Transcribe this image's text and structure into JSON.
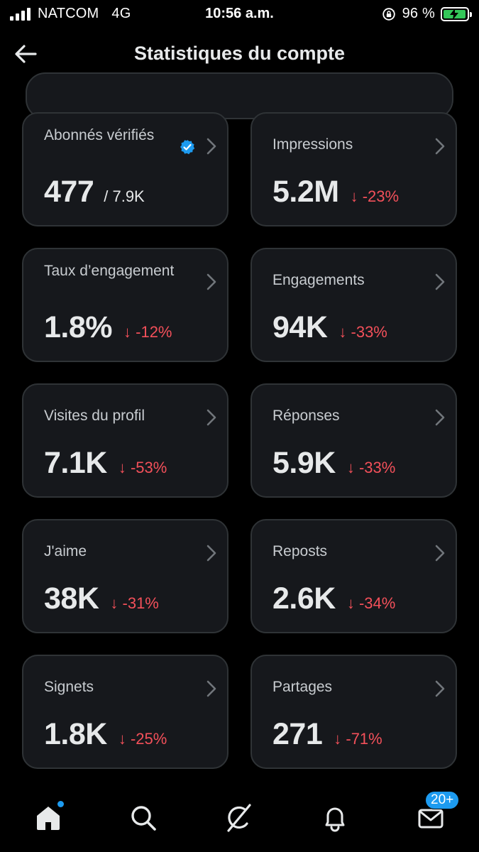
{
  "status_bar": {
    "carrier": "NATCOM",
    "network": "4G",
    "time": "10:56 a.m.",
    "battery": "96 %",
    "battery_level": 0.96
  },
  "header": {
    "title": "Statistiques du compte",
    "back_icon": "arrow-left-icon"
  },
  "colors": {
    "background": "#000000",
    "card": "#16181c",
    "card_border": "#2f3336",
    "negative": "#f3505a",
    "accent": "#1d9bf0"
  },
  "cards": [
    {
      "label": "Abonnés vérifiés",
      "value": "477",
      "sub": "/ 7.9K",
      "change": "",
      "verified": true
    },
    {
      "label": "Impressions",
      "value": "5.2M",
      "sub": "",
      "change": "↓ -23%"
    },
    {
      "label": "Taux d’engagement",
      "value": "1.8%",
      "sub": "",
      "change": "↓ -12%"
    },
    {
      "label": "Engagements",
      "value": "94K",
      "sub": "",
      "change": "↓ -33%"
    },
    {
      "label": "Visites du profil",
      "value": "7.1K",
      "sub": "",
      "change": "↓ -53%"
    },
    {
      "label": "Réponses",
      "value": "5.9K",
      "sub": "",
      "change": "↓ -33%"
    },
    {
      "label": "J'aime",
      "value": "38K",
      "sub": "",
      "change": "↓ -31%"
    },
    {
      "label": "Reposts",
      "value": "2.6K",
      "sub": "",
      "change": "↓ -34%"
    },
    {
      "label": "Signets",
      "value": "1.8K",
      "sub": "",
      "change": "↓ -25%"
    },
    {
      "label": "Partages",
      "value": "271",
      "sub": "",
      "change": "↓ -71%"
    }
  ],
  "bottom_nav": {
    "items": [
      "home-icon",
      "search-icon",
      "grok-icon",
      "bell-icon",
      "mail-icon"
    ],
    "messages_badge": "20+"
  }
}
